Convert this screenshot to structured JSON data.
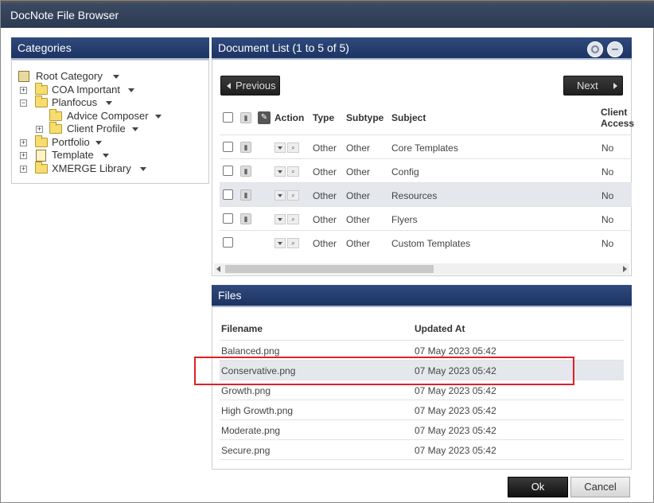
{
  "window": {
    "title": "DocNote File Browser"
  },
  "categories": {
    "header": "Categories",
    "tree": [
      {
        "label": "Root Category",
        "type": "root"
      },
      {
        "label": "COA Important",
        "type": "folder"
      },
      {
        "label": "Planfocus",
        "type": "folder"
      },
      {
        "label": "Advice Composer",
        "type": "folder"
      },
      {
        "label": "Client Profile",
        "type": "folder"
      },
      {
        "label": "Portfolio",
        "type": "folder"
      },
      {
        "label": "Template",
        "type": "doc"
      },
      {
        "label": "XMERGE Library",
        "type": "folder"
      }
    ]
  },
  "doclist": {
    "header": "Document List (1 to 5 of 5)",
    "prev_label": "Previous",
    "next_label": "Next",
    "columns": {
      "action": "Action",
      "type": "Type",
      "subtype": "Subtype",
      "subject": "Subject",
      "client_access_1": "Client",
      "client_access_2": "Access"
    },
    "rows": [
      {
        "type": "Other",
        "subtype": "Other",
        "subject": "Core Templates",
        "access": "No"
      },
      {
        "type": "Other",
        "subtype": "Other",
        "subject": "Config",
        "access": "No"
      },
      {
        "type": "Other",
        "subtype": "Other",
        "subject": "Resources",
        "access": "No"
      },
      {
        "type": "Other",
        "subtype": "Other",
        "subject": "Flyers",
        "access": "No"
      },
      {
        "type": "Other",
        "subtype": "Other",
        "subject": "Custom Templates",
        "access": "No"
      }
    ]
  },
  "files": {
    "header": "Files",
    "columns": {
      "filename": "Filename",
      "updated": "Updated At"
    },
    "rows": [
      {
        "filename": "Balanced.png",
        "updated": "07 May 2023 05:42"
      },
      {
        "filename": "Conservative.png",
        "updated": "07 May 2023 05:42"
      },
      {
        "filename": "Growth.png",
        "updated": "07 May 2023 05:42"
      },
      {
        "filename": "High Growth.png",
        "updated": "07 May 2023 05:42"
      },
      {
        "filename": "Moderate.png",
        "updated": "07 May 2023 05:42"
      },
      {
        "filename": "Secure.png",
        "updated": "07 May 2023 05:42"
      }
    ]
  },
  "footer": {
    "ok_label": "Ok",
    "cancel_label": "Cancel"
  },
  "colors": {
    "header_blue": "#1d3463",
    "highlight_red": "#e0202a",
    "selected_row": "#e4e7ec"
  }
}
